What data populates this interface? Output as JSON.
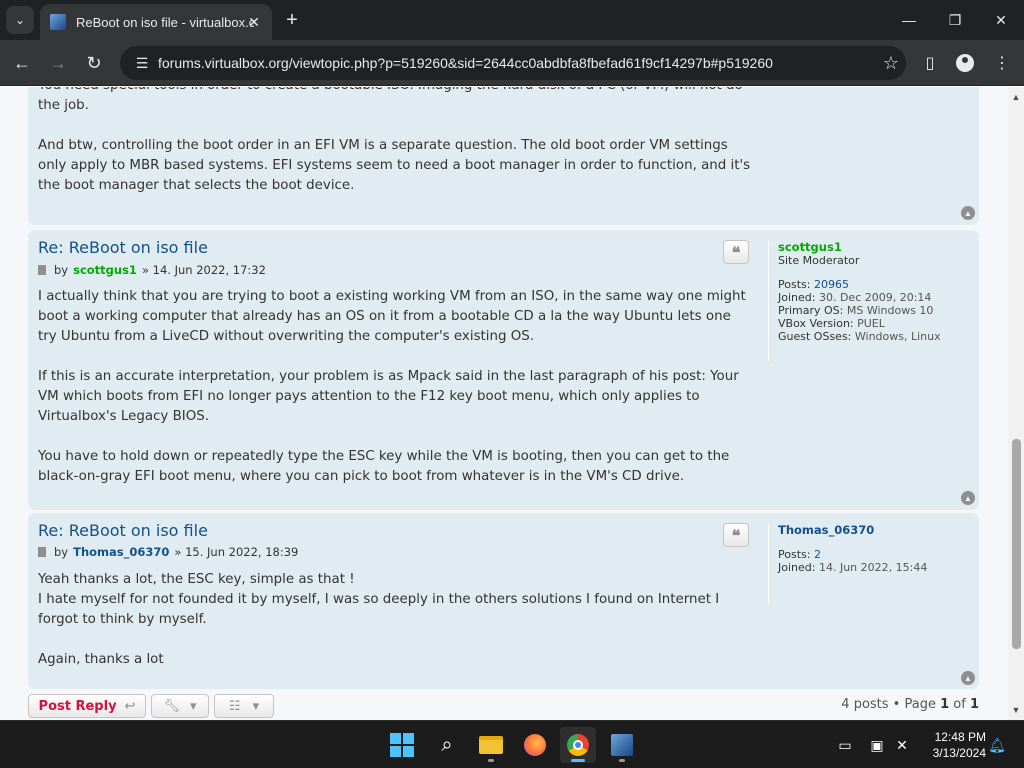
{
  "browser": {
    "tab_title": "ReBoot on iso file - virtualbox.o",
    "url": "forums.virtualbox.org/viewtopic.php?p=519260&sid=2644cc0abdbfa8fbefad61f9cf14297b#p519260",
    "icons": {
      "tab_search": "chevron-down-icon",
      "tab_close": "close-icon",
      "new_tab": "plus-icon",
      "minimize": "minimize-icon",
      "maximize": "restore-icon",
      "close": "close-icon",
      "back": "back-arrow-icon",
      "forward": "forward-arrow-icon",
      "reload": "reload-icon",
      "site_info": "tune-icon",
      "bookmark": "star-icon",
      "side_panel": "side-panel-icon",
      "profile": "profile-icon",
      "menu": "kebab-menu-icon"
    }
  },
  "colors": {
    "post_bg": "#e1ebf2",
    "link_blue": "#105289",
    "moderator_green": "#00aa00",
    "reply_red": "#d31141"
  },
  "posts": [
    {
      "partial": true,
      "paragraphs": [
        "You need special tools in order to create a bootable ISO. Imaging the hard disk of a PC (or VM) will not do the job.",
        "And btw, controlling the boot order in an EFI VM is a separate question. The old boot order VM settings only apply to MBR based systems. EFI systems seem to need a boot manager in order to function, and it's the boot manager that selects the boot device."
      ]
    },
    {
      "title": "Re: ReBoot on iso file",
      "by": "by",
      "author": "scottgus1",
      "date": "» 14. Jun 2022, 17:32",
      "paragraphs": [
        "I actually think that you are trying to boot a existing working VM from an ISO, in the same way one might boot a working computer that already has an OS on it from a bootable CD a la the way Ubuntu lets one try Ubuntu from a LiveCD without overwriting the computer's existing OS.",
        "If this is an accurate interpretation, your problem is as Mpack said in the last paragraph of his post: Your VM which boots from EFI no longer pays attention to the F12 key boot menu, which only applies to Virtualbox's Legacy BIOS.",
        "You have to hold down or repeatedly type the ESC key while the VM is booting, then you can get to the black-on-gray EFI boot menu, where you can pick to boot from whatever is in the VM's CD drive."
      ],
      "profile": {
        "name": "scottgus1",
        "rank": "Site Moderator",
        "posts_label": "Posts:",
        "posts": "20965",
        "joined_label": "Joined:",
        "joined": "30. Dec 2009, 20:14",
        "os_label": "Primary OS:",
        "os": "MS Windows 10",
        "vbox_label": "VBox Version:",
        "vbox": "PUEL",
        "guest_label": "Guest OSses:",
        "guest": "Windows, Linux"
      }
    },
    {
      "title": "Re: ReBoot on iso file",
      "by": "by",
      "author": "Thomas_06370",
      "date": "» 15. Jun 2022, 18:39",
      "lines": [
        "Yeah thanks a lot, the ESC key, simple as that !",
        "I hate myself for not founded it by myself, I was so deeply in the others solutions I found on Internet I forgot to think by myself."
      ],
      "closing": "Again, thanks a lot",
      "profile": {
        "name": "Thomas_06370",
        "posts_label": "Posts:",
        "posts": "2",
        "joined_label": "Joined:",
        "joined": "14. Jun 2022, 15:44"
      }
    }
  ],
  "actions": {
    "post_reply": "Post Reply",
    "pagination_prefix": "4 posts • Page",
    "page_current": "1",
    "page_of": "of",
    "page_total": "1"
  },
  "taskbar": {
    "apps": [
      "start-icon",
      "search-icon",
      "file-explorer-icon",
      "firefox-icon",
      "chrome-icon",
      "virtualbox-icon"
    ],
    "time": "12:48 PM",
    "date": "3/13/2024"
  }
}
